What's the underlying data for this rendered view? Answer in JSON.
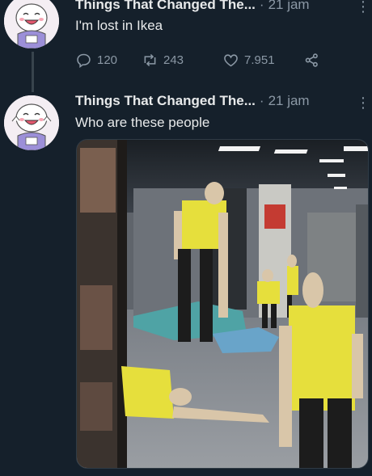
{
  "tweet1": {
    "author": "Things That Changed The...",
    "separator": "·",
    "time": "21 jam",
    "more": "⋮",
    "text": "I'm lost in Ikea",
    "reply_count": "120",
    "retweet_count": "243",
    "like_count": "7.951"
  },
  "tweet2": {
    "author": "Things That Changed The...",
    "separator": "·",
    "time": "21 jam",
    "more": "⋮",
    "text": "Who are these people"
  },
  "colors": {
    "background": "#15202b",
    "text": "#e7e9ea",
    "secondary": "#8b98a5"
  },
  "icons": [
    "reply-icon",
    "retweet-icon",
    "like-icon",
    "share-icon",
    "more-icon"
  ]
}
